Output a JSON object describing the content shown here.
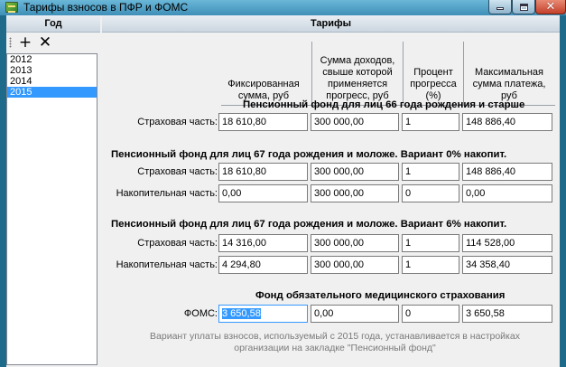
{
  "window": {
    "title": "Тарифы взносов в ПФР и ФОМС",
    "minimize_icon": "minimize-icon",
    "maximize_icon": "maximize-icon",
    "close_icon": "close-icon"
  },
  "left_panel": {
    "header": "Год",
    "add_glyph": "+",
    "delete_glyph": "✕",
    "years": [
      {
        "label": "2012",
        "selected": false
      },
      {
        "label": "2013",
        "selected": false
      },
      {
        "label": "2014",
        "selected": false
      },
      {
        "label": "2015",
        "selected": true
      }
    ]
  },
  "right_panel": {
    "header": "Тарифы",
    "columns": [
      "Фиксированная сумма, руб",
      "Сумма доходов, свыше которой применяется прогресс, руб",
      "Процент прогресса (%)",
      "Максимальная сумма платежа, руб"
    ],
    "sections": [
      {
        "title": "Пенсионный фонд для лиц 66 года рождения и старше",
        "rows": [
          {
            "label": "Страховая часть:",
            "values": [
              "18 610,80",
              "300 000,00",
              "1",
              "148 886,40"
            ]
          }
        ]
      },
      {
        "title": "Пенсионный фонд для лиц 67 года рождения и моложе. Вариант 0% накопит.",
        "rows": [
          {
            "label": "Страховая часть:",
            "values": [
              "18 610,80",
              "300 000,00",
              "1",
              "148 886,40"
            ]
          },
          {
            "label": "Накопительная часть:",
            "values": [
              "0,00",
              "300 000,00",
              "0",
              "0,00"
            ]
          }
        ]
      },
      {
        "title": "Пенсионный фонд для лиц 67 года рождения и моложе. Вариант 6% накопит.",
        "rows": [
          {
            "label": "Страховая часть:",
            "values": [
              "14 316,00",
              "300 000,00",
              "1",
              "114 528,00"
            ]
          },
          {
            "label": "Накопительная часть:",
            "values": [
              "4 294,80",
              "300 000,00",
              "1",
              "34 358,40"
            ]
          }
        ]
      },
      {
        "title": "Фонд обязательного медицинского страхования",
        "rows": [
          {
            "label": "ФОМС:",
            "values": [
              "3 650,58",
              "0,00",
              "0",
              "3 650,58"
            ]
          }
        ]
      }
    ],
    "footer_note": "Вариант уплаты взносов, используемый с 2015 года, устанавливается в настройках организации на закладке \"Пенсионный фонд\""
  },
  "colors": {
    "selection": "#3399ff",
    "title_bar": "#4f9dc4",
    "close_button": "#c8452e"
  }
}
